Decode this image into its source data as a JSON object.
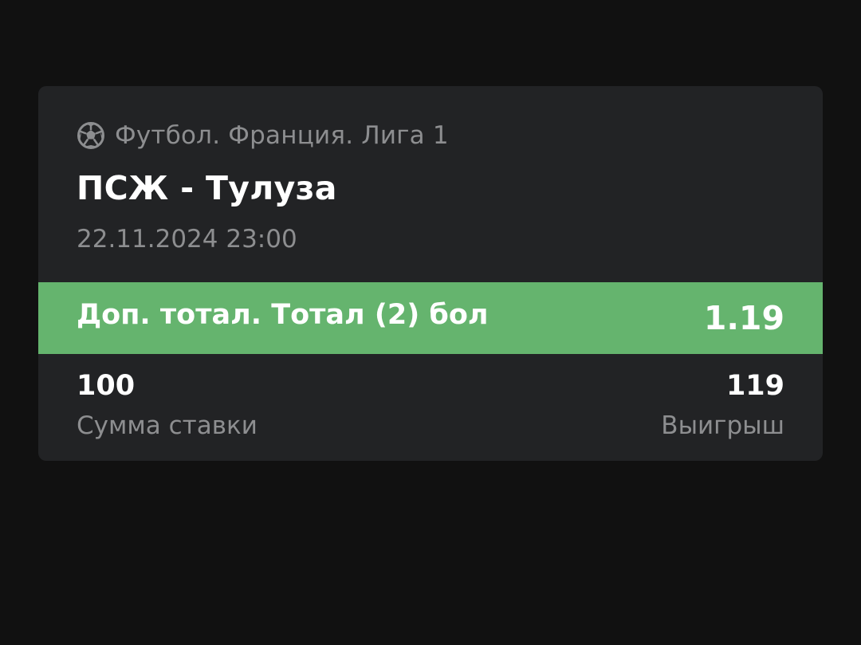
{
  "league": {
    "icon": "soccer-ball-icon",
    "text": "Футбол. Франция. Лига 1"
  },
  "match": {
    "title": "ПСЖ - Тулуза",
    "datetime": "22.11.2024 23:00"
  },
  "bet": {
    "name": "Доп. тотал. Тотал (2) бол",
    "odds": "1.19"
  },
  "stake": {
    "amount": "100",
    "label": "Сумма ставки"
  },
  "win": {
    "amount": "119",
    "label": "Выигрыш"
  },
  "colors": {
    "background": "#111111",
    "card": "#222325",
    "accent": "#65b46e",
    "muted_text": "#8d8e90"
  }
}
